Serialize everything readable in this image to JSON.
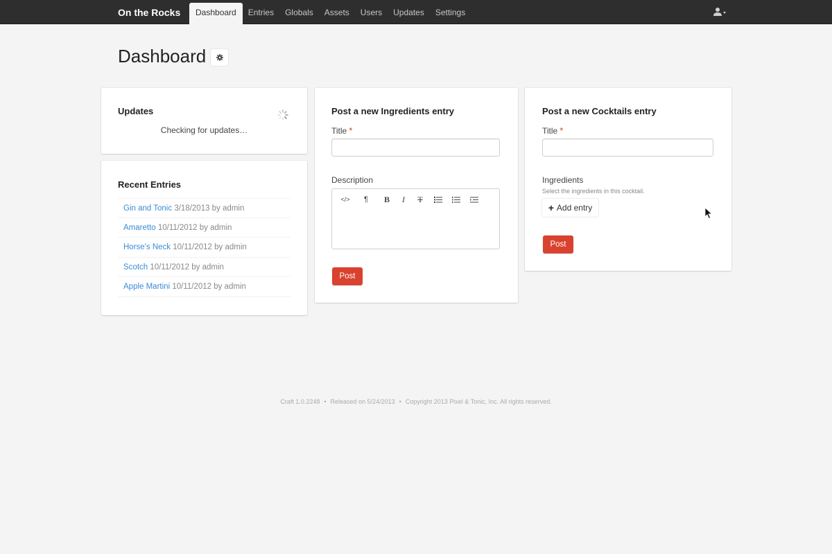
{
  "site": {
    "name": "On the Rocks"
  },
  "nav": {
    "items": [
      {
        "label": "Dashboard",
        "active": true
      },
      {
        "label": "Entries"
      },
      {
        "label": "Globals"
      },
      {
        "label": "Assets"
      },
      {
        "label": "Users"
      },
      {
        "label": "Updates"
      },
      {
        "label": "Settings"
      }
    ],
    "user_menu_icon": "user-icon"
  },
  "page": {
    "title": "Dashboard",
    "settings_icon": "gear-icon"
  },
  "updates_widget": {
    "title": "Updates",
    "status": "Checking for updates…",
    "spinner_icon": "spinner-icon"
  },
  "recent_entries": {
    "title": "Recent Entries",
    "items": [
      {
        "title": "Gin and Tonic",
        "meta": "3/18/2013 by admin"
      },
      {
        "title": "Amaretto",
        "meta": "10/11/2012 by admin"
      },
      {
        "title": "Horse's Neck",
        "meta": "10/11/2012 by admin"
      },
      {
        "title": "Scotch",
        "meta": "10/11/2012 by admin"
      },
      {
        "title": "Apple Martini",
        "meta": "10/11/2012 by admin"
      }
    ]
  },
  "ingredients_widget": {
    "title": "Post a new Ingredients entry",
    "title_label": "Title",
    "title_value": "",
    "description_label": "Description",
    "description_value": "",
    "toolbar": [
      "</>",
      "¶",
      "B",
      "I",
      "T",
      "list",
      "ordered-list",
      "indent"
    ],
    "post_label": "Post"
  },
  "cocktails_widget": {
    "title": "Post a new Cocktails entry",
    "title_label": "Title",
    "title_value": "",
    "ingredients_label": "Ingredients",
    "ingredients_instructions": "Select the ingredients in this cocktail.",
    "add_entry_label": "Add entry",
    "post_label": "Post"
  },
  "footer": {
    "version": "Craft 1.0.2248",
    "released": "Released on 5/24/2013",
    "copyright": "Copyright 2013 Pixel & Tonic, Inc. All rights reserved."
  },
  "colors": {
    "topbar": "#2e2e2e",
    "background": "#f4f4f4",
    "link": "#3a8ad6",
    "primary_button": "#d9422f",
    "required": "#d9422f"
  }
}
